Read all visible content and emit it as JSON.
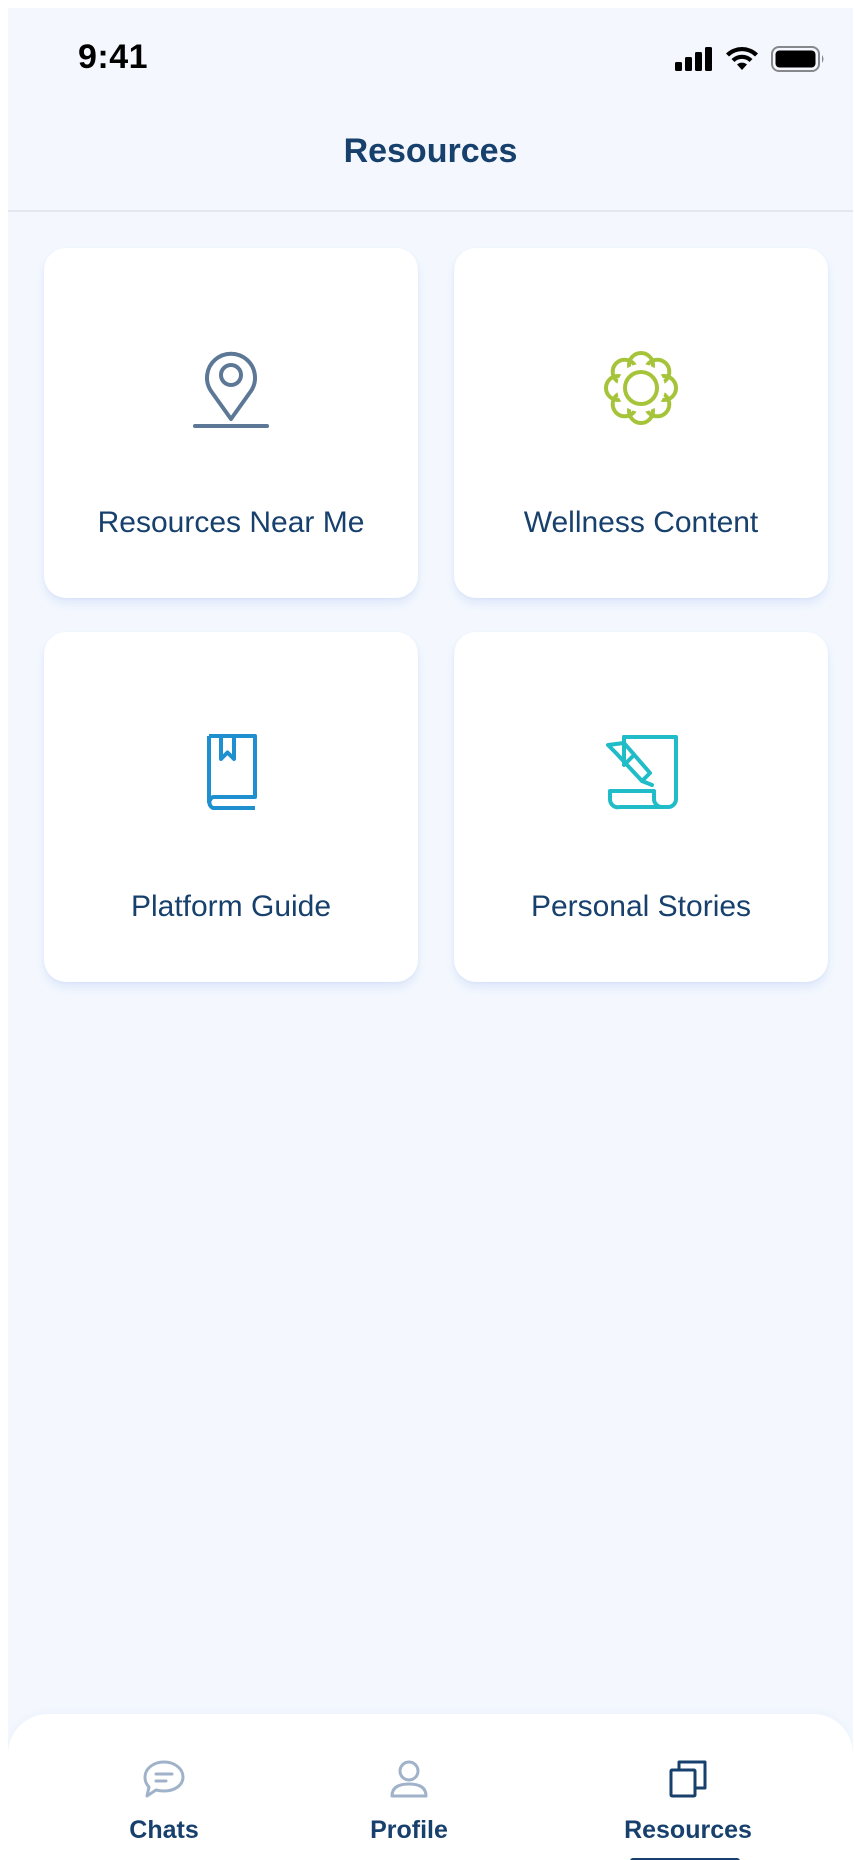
{
  "status_bar": {
    "time": "9:41",
    "icons": [
      "cellular-signal-icon",
      "wifi-icon",
      "battery-icon"
    ]
  },
  "header": {
    "title": "Resources"
  },
  "cards": [
    {
      "label": "Resources Near Me",
      "icon": "location-pin-icon",
      "icon_color": "#5c7896"
    },
    {
      "label": "Wellness Content",
      "icon": "flower-icon",
      "icon_color": "#a6c43a"
    },
    {
      "label": "Platform Guide",
      "icon": "book-icon",
      "icon_color": "#1e8fcf"
    },
    {
      "label": "Personal Stories",
      "icon": "scroll-quill-icon",
      "icon_color": "#20bcc7"
    }
  ],
  "tab_bar": {
    "tabs": [
      {
        "label": "Chats",
        "icon": "chat-bubble-icon",
        "active": false
      },
      {
        "label": "Profile",
        "icon": "user-icon",
        "active": false
      },
      {
        "label": "Resources",
        "icon": "stacked-squares-icon",
        "active": true
      }
    ]
  },
  "colors": {
    "background": "#f4f8fe",
    "title": "#17406d",
    "inactive_icon": "#9fb2c9",
    "active_icon": "#17406d"
  }
}
